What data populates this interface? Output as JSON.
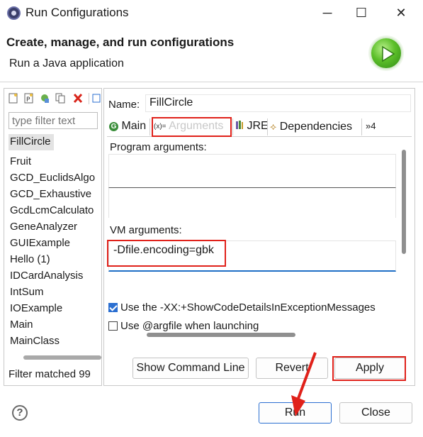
{
  "window": {
    "title": "Run Configurations",
    "minimize_glyph": "─",
    "maximize_glyph": "☐",
    "close_glyph": "✕"
  },
  "banner": {
    "title": "Create, manage, and run configurations",
    "subtitle": "Run a Java application"
  },
  "left_panel": {
    "toolbar_icons": [
      "new-configuration-icon",
      "new-prototype-icon",
      "export-icon",
      "duplicate-icon",
      "delete-icon",
      "collapse-icon"
    ],
    "filter_placeholder": "type filter text",
    "items": [
      {
        "label": "FillCircle",
        "selected": true
      },
      {
        "label": "Fruit"
      },
      {
        "label": "GCD_EuclidsAlgo"
      },
      {
        "label": "GCD_Exhaustive"
      },
      {
        "label": "GcdLcmCalculato"
      },
      {
        "label": "GeneAnalyzer"
      },
      {
        "label": "GUIExample"
      },
      {
        "label": "Hello (1)"
      },
      {
        "label": "IDCardAnalysis"
      },
      {
        "label": "IntSum"
      },
      {
        "label": "IOExample"
      },
      {
        "label": "Main"
      },
      {
        "label": "MainClass"
      }
    ],
    "footer": "Filter matched 99"
  },
  "config": {
    "name_label": "Name:",
    "name_value": "FillCircle",
    "tabs": [
      {
        "label": "Main",
        "icon": "main-tab-icon"
      },
      {
        "label": "Arguments",
        "icon": "arguments-tab-icon",
        "active": true
      },
      {
        "label": "JRE",
        "icon": "jre-tab-icon"
      },
      {
        "label": "Dependencies",
        "icon": "dependencies-tab-icon"
      },
      {
        "label": "»4",
        "icon": "more-tabs-icon"
      }
    ],
    "tab_icon_glyphs": {
      "main": "G",
      "arguments": "(x)=",
      "dependencies": "⟡"
    },
    "program_arguments_label": "Program arguments:",
    "program_arguments_value": "",
    "vm_arguments_label": "VM arguments:",
    "vm_arguments_value": "-Dfile.encoding=gbk",
    "checkbox1_label": "Use the -XX:+ShowCodeDetailsInExceptionMessages",
    "checkbox1_checked": true,
    "checkbox2_label": "Use @argfile when launching",
    "checkbox2_checked": false
  },
  "buttons": {
    "show_command_line": "Show Command Line",
    "revert": "Revert",
    "apply": "Apply",
    "run": "Run",
    "close": "Close",
    "help": "?"
  },
  "colors": {
    "accent": "#2b6fd1",
    "highlight": "#e0211a",
    "selection": "#e3e3e3",
    "run_green": "#5cbf2a"
  }
}
